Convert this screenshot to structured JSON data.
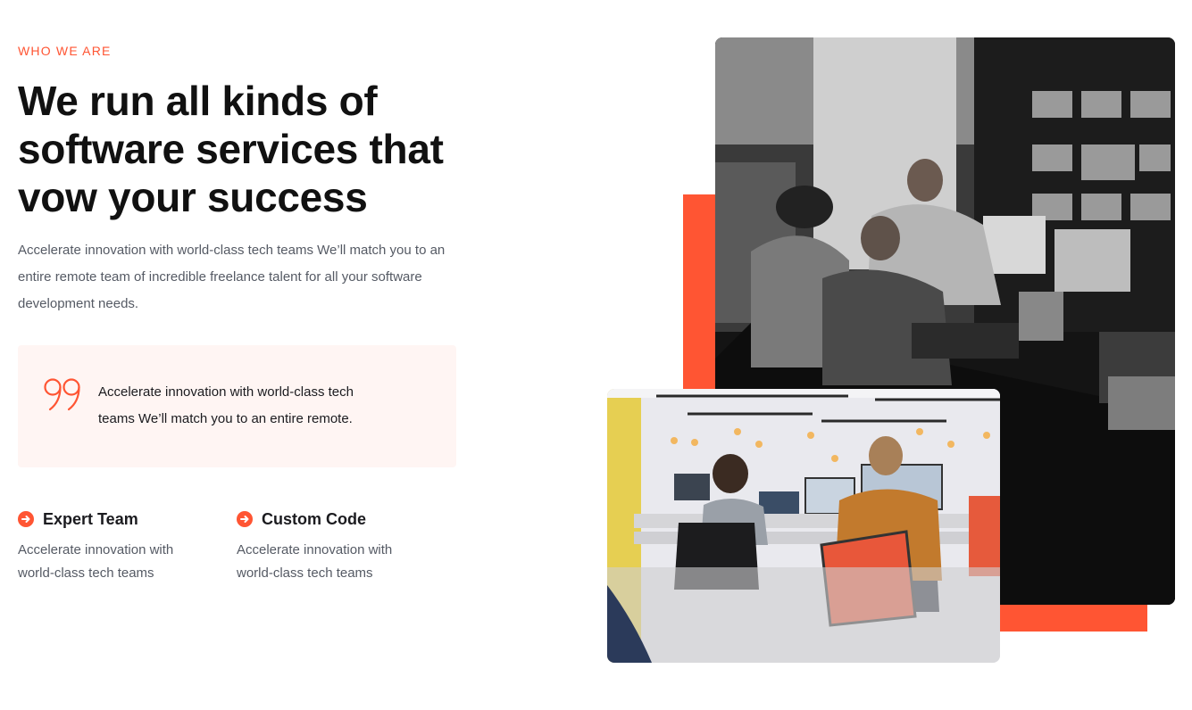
{
  "section": {
    "eyebrow": "WHO WE ARE",
    "title": "We run all kinds of software services that vow your success",
    "description": "Accelerate innovation with world-class tech teams We’ll match you to an entire remote team of incredible freelance talent for all your software development needs."
  },
  "quote": {
    "icon": "quote-icon",
    "text": "Accelerate innovation with world-class tech teams We’ll match you to an entire remote."
  },
  "features": [
    {
      "icon": "arrow-right-circle-icon",
      "title": "Expert Team",
      "description": "Accelerate innovation with world-class tech teams"
    },
    {
      "icon": "arrow-right-circle-icon",
      "title": "Custom Code",
      "description": "Accelerate innovation with world-class tech teams"
    }
  ],
  "colors": {
    "accent": "#ff5533",
    "quote_background": "#fff5f3",
    "heading": "#111111",
    "body_text": "#555a64"
  },
  "images": {
    "main": "control-room-photo",
    "secondary": "office-team-photo"
  }
}
